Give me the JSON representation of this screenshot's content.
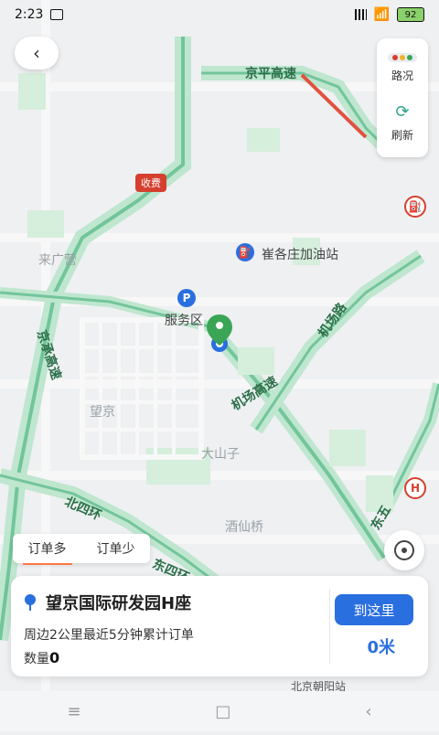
{
  "status_bar": {
    "time": "2:23",
    "battery": "92"
  },
  "map": {
    "labels": {
      "jingping_highway": "京平高速",
      "laiguangying": "来广营",
      "gas_station": "崔各庄加油站",
      "service_area": "服务区",
      "jingcheng_highway": "京承高速",
      "airport_highway": "机场高速",
      "wangjing": "望京",
      "dashanzi": "大山子",
      "jiuxianqiao": "酒仙桥",
      "east_4th_ring": "北四环",
      "east_4th_ring_2": "东四环",
      "dongwu_road": "东五",
      "airport_road": "机场路",
      "beijing_chaoyang_station": "北京朝阳站"
    },
    "toll_label": "收费",
    "colors": {
      "road": "#bfe6cf",
      "road_border": "#72c59b",
      "park": "#d6eedc",
      "route_red": "#e0533f"
    }
  },
  "back_button": {
    "icon": "chevron-left-icon",
    "label": "‹"
  },
  "side_panel": {
    "traffic_label": "路况",
    "refresh_label": "刷新"
  },
  "order_tabs": {
    "many": "订单多",
    "few": "订单少"
  },
  "location_card": {
    "title": "望京国际研发园H座",
    "line1": "周边2公里最近5分钟累计订单",
    "line2": "数量",
    "count": "0",
    "go_label": "到这里",
    "distance": "0米"
  },
  "nav_bar": {
    "menu_icon": "menu-icon",
    "home_icon": "home-icon",
    "back_icon": "back-icon"
  }
}
